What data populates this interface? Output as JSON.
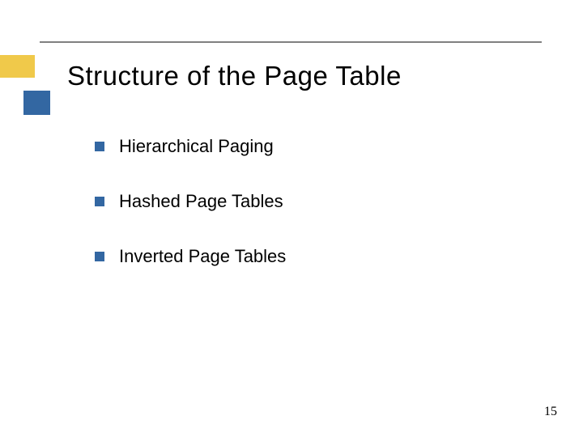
{
  "slide": {
    "title": "Structure of the Page Table",
    "bullets": [
      {
        "text": "Hierarchical Paging"
      },
      {
        "text": "Hashed Page Tables"
      },
      {
        "text": "Inverted Page Tables"
      }
    ],
    "page_number": "15"
  }
}
